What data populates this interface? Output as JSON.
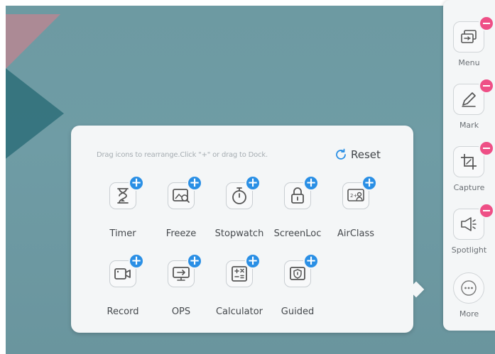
{
  "panel": {
    "hint": "Drag icons to rearrange.Click \"+\" or drag to Dock.",
    "reset_label": "Reset",
    "apps": [
      {
        "label": "Timer",
        "icon": "hourglass-icon"
      },
      {
        "label": "Freeze",
        "icon": "freeze-icon"
      },
      {
        "label": "Stopwatch",
        "icon": "stopwatch-icon"
      },
      {
        "label": "ScreenLoc",
        "icon": "lock-icon"
      },
      {
        "label": "AirClass",
        "icon": "airclass-icon"
      },
      {
        "label": "Record",
        "icon": "video-record-icon"
      },
      {
        "label": "OPS",
        "icon": "monitor-icon"
      },
      {
        "label": "Calculator",
        "icon": "calculator-icon"
      },
      {
        "label": "Guided",
        "icon": "shield-icon"
      }
    ],
    "add_symbol": "+",
    "airclass_glyph": "2+"
  },
  "dock": {
    "items": [
      {
        "label": "Menu",
        "icon": "menu-window-icon"
      },
      {
        "label": "Mark",
        "icon": "pen-icon"
      },
      {
        "label": "Capture",
        "icon": "crop-icon"
      },
      {
        "label": "Spotlight",
        "icon": "spotlight-icon"
      },
      {
        "label": "More",
        "icon": "more-icon"
      }
    ]
  },
  "colors": {
    "background": "#6d9aa2",
    "panel": "#f4f6f7",
    "add_badge": "#2a8fe5",
    "remove_badge": "#ee4f86",
    "reset_icon": "#2a8fe5"
  }
}
